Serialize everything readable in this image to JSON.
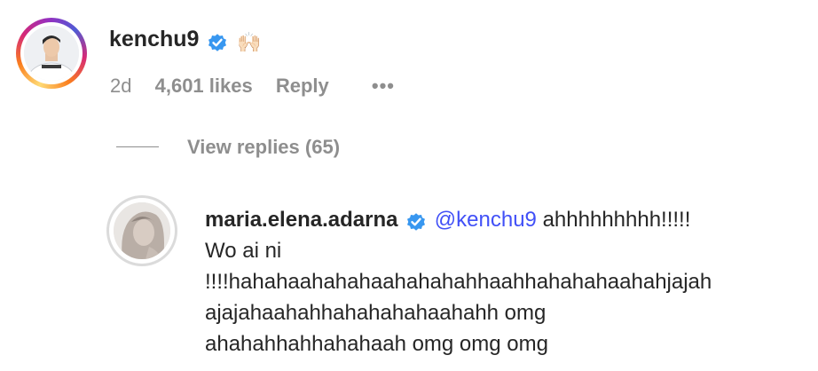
{
  "comment": {
    "username": "kenchu9",
    "reaction_emoji": "🙌🏻",
    "age": "2d",
    "likes": "4,601 likes",
    "reply_label": "Reply",
    "more_label": "•••"
  },
  "replies_toggle": {
    "label": "View replies (65)"
  },
  "reply": {
    "username": "maria.elena.adarna",
    "mention": "@kenchu9",
    "text_line1": "ahhhhhhhhh!!!!!",
    "text_line2": "Wo ai ni",
    "text_line3": "!!!!hahahaahahahaahahahahhaahhahahahaahahjajah",
    "text_line4": "ajajahaahahhahahahahaahahh omg",
    "text_line5": "ahahahhahhahahaah omg omg omg"
  },
  "colors": {
    "text": "#262626",
    "muted": "#8e8e8e",
    "mention": "#4150f7",
    "verified": "#3897f0"
  },
  "icons": {
    "verified": "verified-badge-icon",
    "more": "more-horizontal-icon"
  }
}
